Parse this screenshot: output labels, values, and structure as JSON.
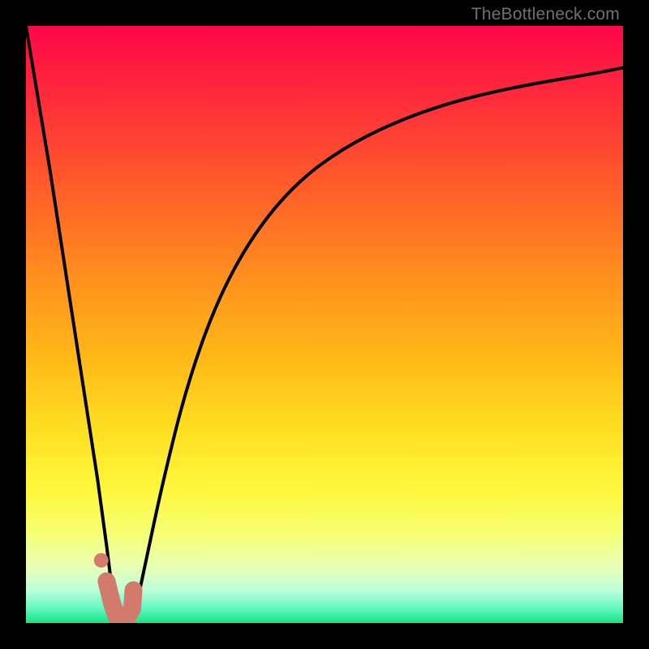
{
  "watermark": "TheBottleneck.com",
  "colors": {
    "frame_bg": "#000000",
    "curve_stroke": "#000000",
    "marker_fill": "#d27b6c",
    "watermark": "#72716f"
  },
  "chart_data": {
    "type": "line",
    "title": "",
    "xlabel": "",
    "ylabel": "",
    "xlim": [
      0,
      100
    ],
    "ylim": [
      0,
      100
    ],
    "grid": false,
    "gradient_bands": [
      {
        "pos": 0.0,
        "color": "#ff0748"
      },
      {
        "pos": 0.12,
        "color": "#ff2b3b"
      },
      {
        "pos": 0.28,
        "color": "#ff6028"
      },
      {
        "pos": 0.42,
        "color": "#ff8f1e"
      },
      {
        "pos": 0.55,
        "color": "#ffb718"
      },
      {
        "pos": 0.68,
        "color": "#ffe022"
      },
      {
        "pos": 0.78,
        "color": "#fff83f"
      },
      {
        "pos": 0.85,
        "color": "#f6ff72"
      },
      {
        "pos": 0.905,
        "color": "#e9ffb5"
      },
      {
        "pos": 0.945,
        "color": "#bdffda"
      },
      {
        "pos": 0.975,
        "color": "#63f7c2"
      },
      {
        "pos": 1.0,
        "color": "#17e47f"
      }
    ],
    "series": [
      {
        "name": "left-branch",
        "x": [
          0,
          2,
          4,
          6,
          8,
          10,
          12,
          13.5,
          14.5,
          15.2
        ],
        "y": [
          100,
          88,
          76,
          63,
          50,
          37,
          24,
          13,
          5,
          0.5
        ]
      },
      {
        "name": "right-branch",
        "x": [
          18,
          20,
          23,
          27,
          32,
          38,
          45,
          53,
          62,
          72,
          83,
          95,
          100
        ],
        "y": [
          0.5,
          10,
          24,
          40,
          54,
          65,
          73.5,
          79.5,
          84,
          87.5,
          90,
          92,
          93
        ]
      }
    ],
    "marker": {
      "x": [
        13.5,
        14.5,
        15.2,
        16.0,
        17.0,
        17.8,
        18.0
      ],
      "y": [
        7.0,
        3.0,
        1.0,
        1.0,
        1.0,
        2.5,
        5.5
      ]
    }
  }
}
